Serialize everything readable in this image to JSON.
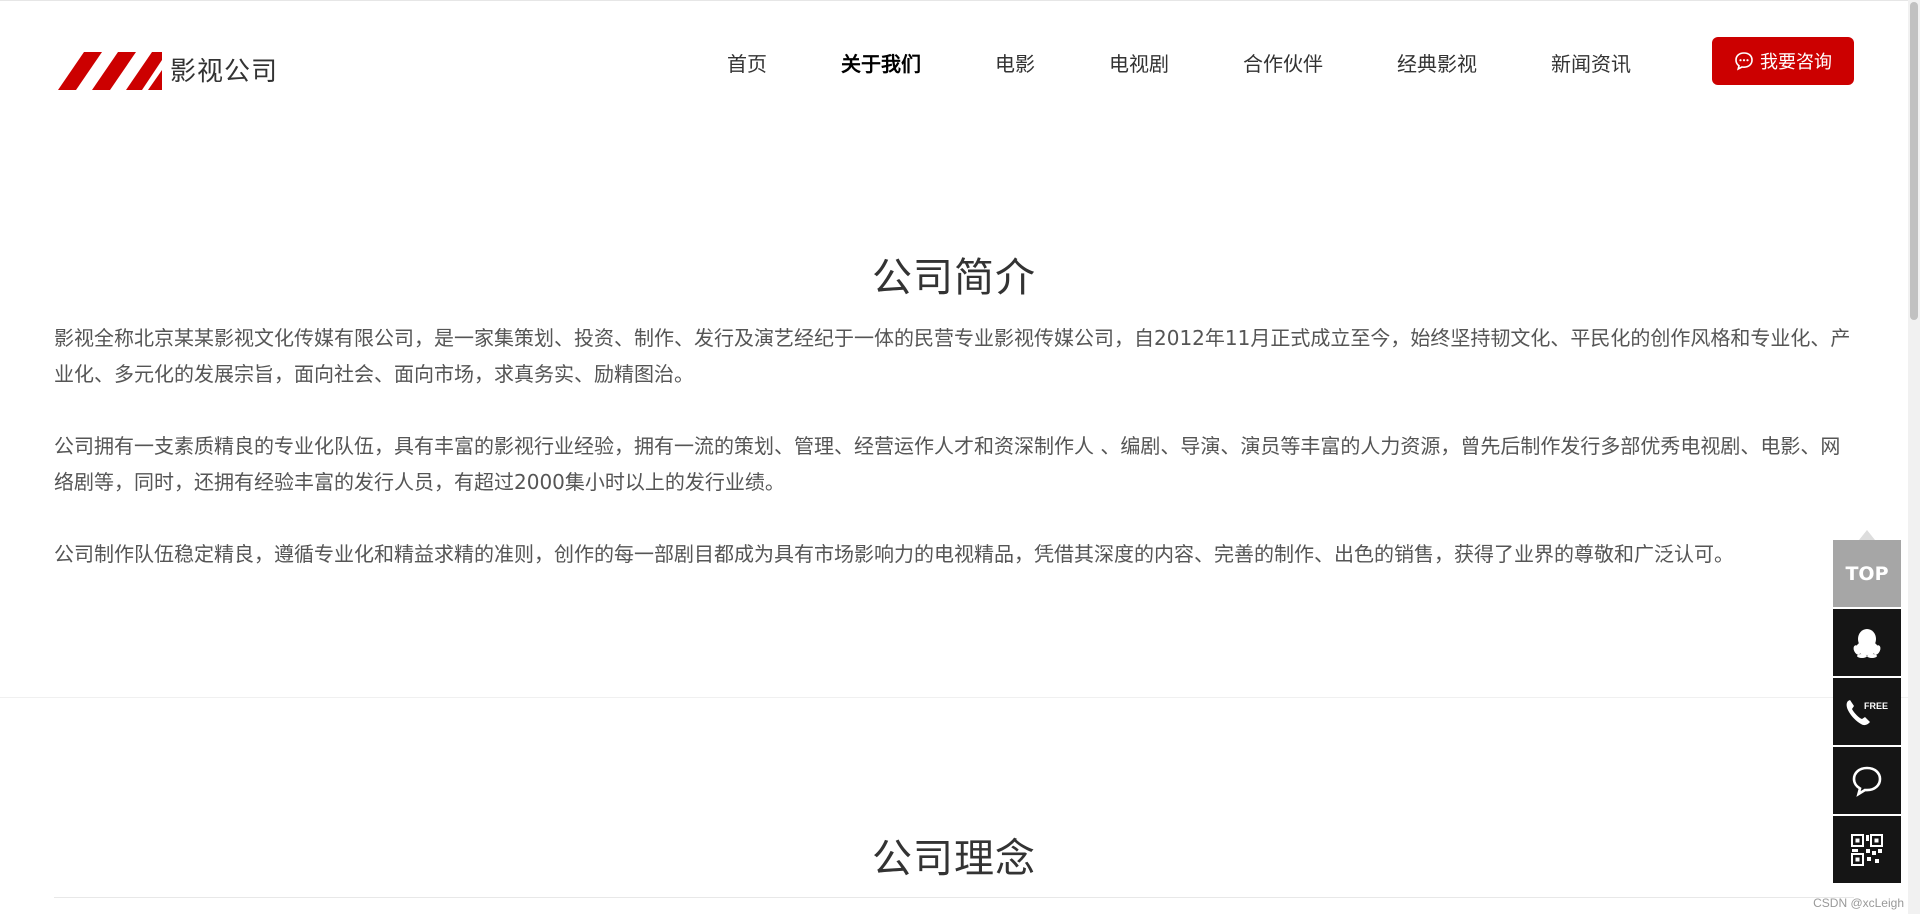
{
  "brand": {
    "name": "影视公司",
    "accent_color": "#cc0000"
  },
  "nav": {
    "items": [
      {
        "label": "首页",
        "active": false
      },
      {
        "label": "关于我们",
        "active": true
      },
      {
        "label": "电影",
        "active": false
      },
      {
        "label": "电视剧",
        "active": false
      },
      {
        "label": "合作伙伴",
        "active": false
      },
      {
        "label": "经典影视",
        "active": false
      },
      {
        "label": "新闻资讯",
        "active": false
      }
    ],
    "consult_label": "我要咨询",
    "consult_icon": "chat-bubble-icon"
  },
  "intro": {
    "title": "公司简介",
    "paragraphs": [
      "影视全称北京某某影视文化传媒有限公司，是一家集策划、投资、制作、发行及演艺经纪于一体的民营专业影视传媒公司，自2012年11月正式成立至今，始终坚持韧文化、平民化的创作风格和专业化、产业化、多元化的发展宗旨，面向社会、面向市场，求真务实、励精图治。",
      "公司拥有一支素质精良的专业化队伍，具有丰富的影视行业经验，拥有一流的策划、管理、经营运作人才和资深制作人 、编剧、导演、演员等丰富的人力资源，曾先后制作发行多部优秀电视剧、电影、网络剧等，同时，还拥有经验丰富的发行人员，有超过2000集小时以上的发行业绩。",
      "公司制作队伍稳定精良，遵循专业化和精益求精的准则，创作的每一部剧目都成为具有市场影响力的电视精品，凭借其深度的内容、完善的制作、出色的销售，获得了业界的尊敬和广泛认可。"
    ]
  },
  "concept": {
    "title": "公司理念"
  },
  "side_tools": {
    "top_label": "TOP",
    "icons": [
      "qq-icon",
      "free-phone-icon",
      "chat-icon",
      "qr-code-icon"
    ],
    "phone_badge": "FREE"
  },
  "watermark": "CSDN @xcLeigh"
}
